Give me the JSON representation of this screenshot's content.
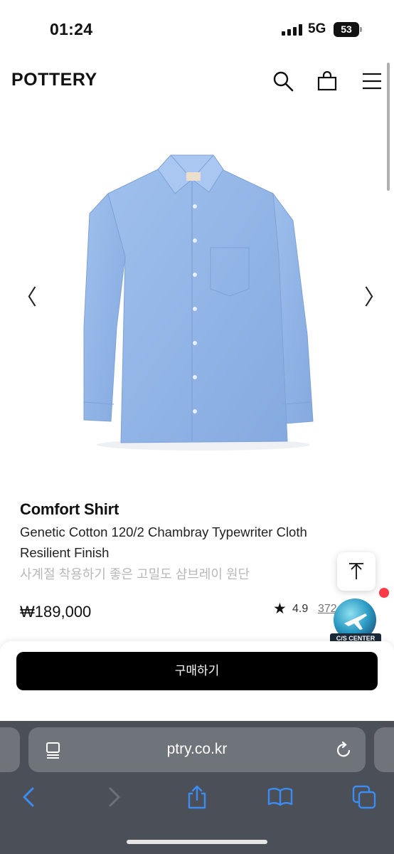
{
  "status_bar": {
    "time": "01:24",
    "network": "5G",
    "battery": "53"
  },
  "header": {
    "brand": "POTTERY",
    "icons": [
      "search-icon",
      "shopping-bag-icon",
      "menu-icon"
    ]
  },
  "carousel": {
    "prev": "〈",
    "next": "〉",
    "image": "blue-chambray-shirt"
  },
  "product": {
    "name": "Comfort Shirt",
    "description": "Genetic Cotton 120/2 Chambray Typewriter Cloth Resilient Finish",
    "subtitle": "사계절 착용하기 좋은 고밀도 샴브레이 원단",
    "price": "₩189,000",
    "rating_star": "★",
    "rating": "4.9",
    "review_count": "372"
  },
  "floating": {
    "cs_label": "C/S CENTER"
  },
  "purchase": {
    "buy_label": "구매하기"
  },
  "browser": {
    "url": "ptry.co.kr"
  },
  "colors": {
    "accent": "#000000",
    "shirt": "#8fb3e6",
    "browser_bar": "#4b4f57",
    "safari_blue": "#3b8df5",
    "notify": "#ff3b47"
  }
}
